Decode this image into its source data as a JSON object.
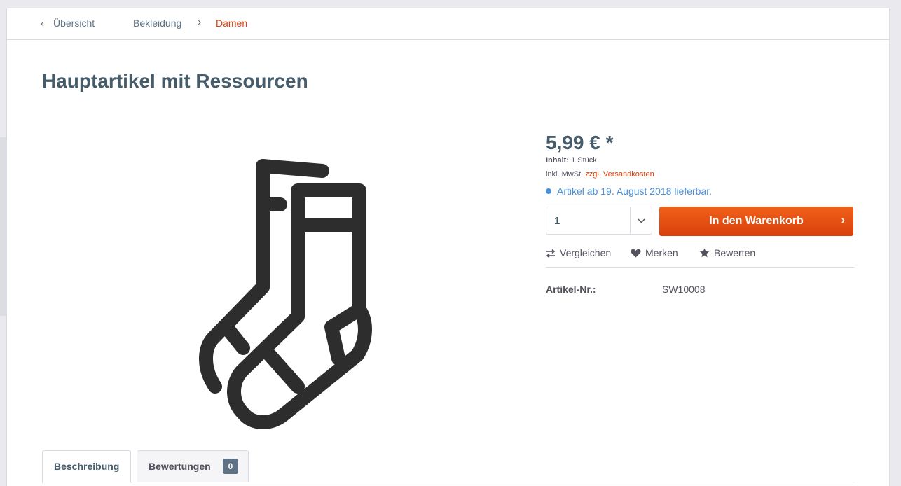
{
  "breadcrumb": {
    "back_label": "Übersicht",
    "items": [
      "Bekleidung",
      "Damen"
    ]
  },
  "product": {
    "title": "Hauptartikel mit Ressourcen",
    "image_icon": "socks-icon"
  },
  "buybox": {
    "price": "5,99 € *",
    "unit_label": "Inhalt:",
    "unit_value": "1 Stück",
    "tax_text": "inkl. MwSt.",
    "shipping_link": "zzgl. Versandkosten",
    "delivery_text": "Artikel ab 19. August 2018 lieferbar.",
    "quantity": "1",
    "cart_button": "In den Warenkorb",
    "actions": {
      "compare": "Vergleichen",
      "note": "Merken",
      "rate": "Bewerten"
    },
    "article_number_label": "Artikel-Nr.:",
    "article_number": "SW10008"
  },
  "tabs": {
    "description": "Beschreibung",
    "reviews": "Bewertungen",
    "reviews_count": "0"
  },
  "colors": {
    "accent": "#d9400b",
    "button": "#e8530f",
    "delivery": "#4a90d9",
    "title": "#475c6a"
  }
}
